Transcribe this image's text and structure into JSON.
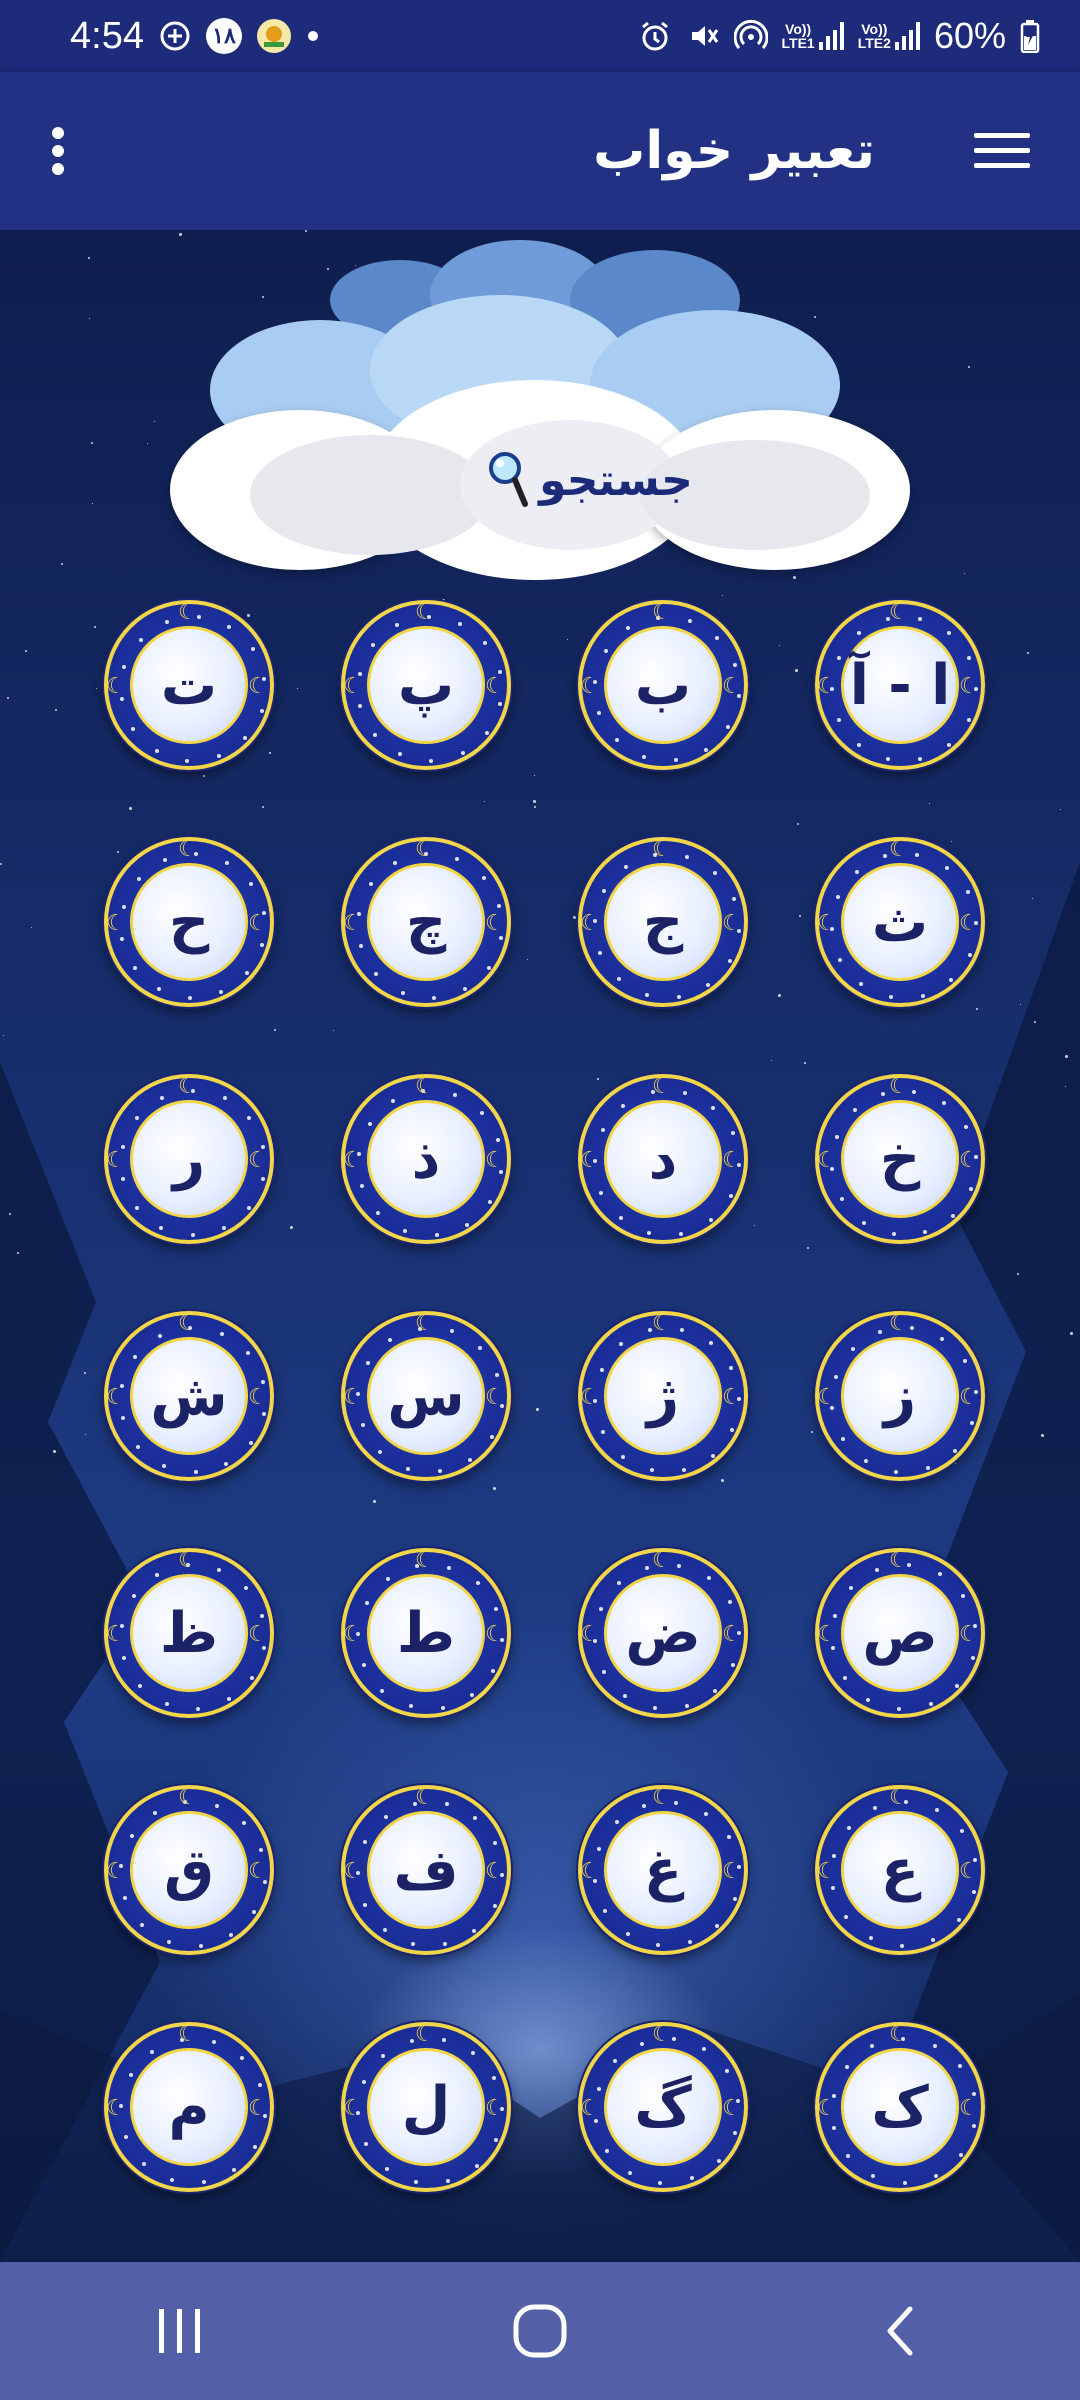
{
  "status_bar": {
    "time": "4:54",
    "notification_badge": "۱۸",
    "lte1": "LTE1",
    "lte2": "LTE2",
    "vo": "Vo))",
    "battery": "60%"
  },
  "app_bar": {
    "title": "تعبیر خواب",
    "menu_icon": "hamburger-icon",
    "more_icon": "more-vert-icon"
  },
  "search": {
    "label": "جستجو",
    "icon": "magnifier-icon"
  },
  "letters": [
    "ا - آ",
    "ب",
    "پ",
    "ت",
    "ث",
    "ج",
    "چ",
    "ح",
    "خ",
    "د",
    "ذ",
    "ر",
    "ز",
    "ژ",
    "س",
    "ش",
    "ص",
    "ض",
    "ط",
    "ظ",
    "ع",
    "غ",
    "ف",
    "ق",
    "ک",
    "گ",
    "ل",
    "م"
  ],
  "colors": {
    "status_bar": "#1e2a7a",
    "app_bar": "#233185",
    "nav_bar": "#5360a8",
    "badge_ring": "#f2d64a",
    "letter_text": "#1b2366"
  }
}
